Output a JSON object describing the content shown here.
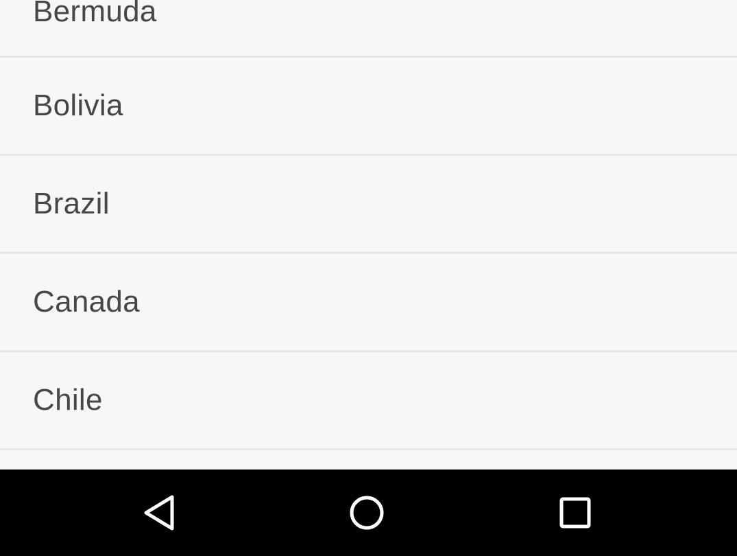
{
  "list": {
    "items": [
      {
        "label": "Bermuda"
      },
      {
        "label": "Bolivia"
      },
      {
        "label": "Brazil"
      },
      {
        "label": "Canada"
      },
      {
        "label": "Chile"
      },
      {
        "label": ""
      }
    ]
  },
  "navbar": {
    "back_icon": "back-triangle-icon",
    "home_icon": "home-circle-icon",
    "recents_icon": "recents-square-icon"
  },
  "colors": {
    "list_background": "#f7f7f7",
    "divider": "#e6e6e6",
    "text": "#474747",
    "navbar_background": "#000000",
    "nav_icon": "#ffffff"
  }
}
